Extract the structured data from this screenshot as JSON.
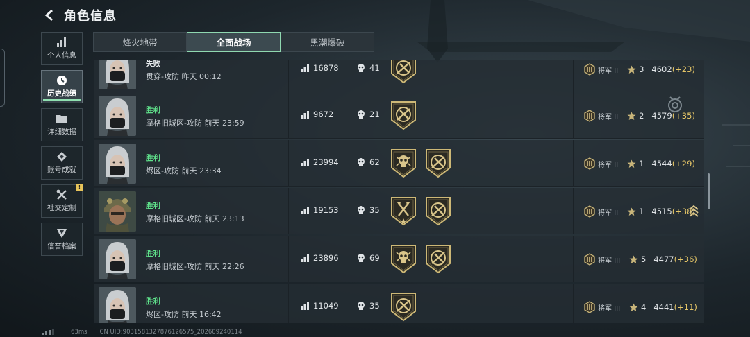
{
  "header": {
    "title": "角色信息"
  },
  "sidebar": {
    "items": [
      {
        "label": "个人信息",
        "icon": "bar-chart-icon",
        "active": false
      },
      {
        "label": "历史战绩",
        "icon": "clock-icon",
        "active": true
      },
      {
        "label": "详细数据",
        "icon": "folder-icon",
        "active": false
      },
      {
        "label": "账号成就",
        "icon": "achievement-icon",
        "active": false
      },
      {
        "label": "社交定制",
        "icon": "tools-icon",
        "active": false,
        "badge": "!"
      },
      {
        "label": "信誉档案",
        "icon": "shield-icon",
        "active": false
      }
    ]
  },
  "tabs": [
    {
      "label": "烽火地带",
      "active": false
    },
    {
      "label": "全面战场",
      "active": true
    },
    {
      "label": "黑潮爆破",
      "active": false
    }
  ],
  "matches": [
    {
      "result": "失败",
      "outcome": "loss",
      "map": "贯穿-攻防 昨天 00:12",
      "score": "16878",
      "kills": "41",
      "medals": [
        "rifle-medal"
      ],
      "rank": "将军 II",
      "level": "3",
      "points": "4602",
      "delta": "(+23)",
      "avatar": "female-operator"
    },
    {
      "result": "胜利",
      "outcome": "win",
      "map": "摩格旧城区-攻防 前天 23:59",
      "score": "9672",
      "kills": "21",
      "medals": [
        "rifle-medal"
      ],
      "rank": "将军 II",
      "level": "2",
      "points": "4579",
      "delta": "(+35)",
      "avatar": "female-operator"
    },
    {
      "result": "胜利",
      "outcome": "win",
      "map": "烬区-攻防 前天 23:34",
      "score": "23994",
      "kills": "62",
      "medals": [
        "skull-medal",
        "rifle-medal"
      ],
      "rank": "将军 II",
      "level": "1",
      "points": "4544",
      "delta": "(+29)",
      "avatar": "female-operator"
    },
    {
      "result": "胜利",
      "outcome": "win",
      "map": "摩格旧城区-攻防 前天 23:13",
      "score": "19153",
      "kills": "35",
      "medals": [
        "axe-medal",
        "rifle-medal"
      ],
      "rank": "将军 II",
      "level": "1",
      "points": "4515",
      "delta": "(+38)",
      "avatar": "male-operator",
      "promoted": true
    },
    {
      "result": "胜利",
      "outcome": "win",
      "map": "摩格旧城区-攻防 前天 22:26",
      "score": "23896",
      "kills": "69",
      "medals": [
        "skull-medal",
        "rifle-medal"
      ],
      "rank": "将军 III",
      "level": "5",
      "points": "4477",
      "delta": "(+36)",
      "avatar": "female-operator"
    },
    {
      "result": "胜利",
      "outcome": "win",
      "map": "烬区-攻防 前天 16:42",
      "score": "11049",
      "kills": "35",
      "medals": [
        "rifle-medal"
      ],
      "rank": "将军 III",
      "level": "4",
      "points": "4441",
      "delta": "(+11)",
      "avatar": "female-operator"
    }
  ],
  "footer": {
    "ping": "63ms",
    "uid": "CN UID:9031581327876126575_202609240114"
  },
  "colors": {
    "win": "#5fe08a",
    "accent": "#8fe0b0",
    "gold": "#e6c667"
  }
}
